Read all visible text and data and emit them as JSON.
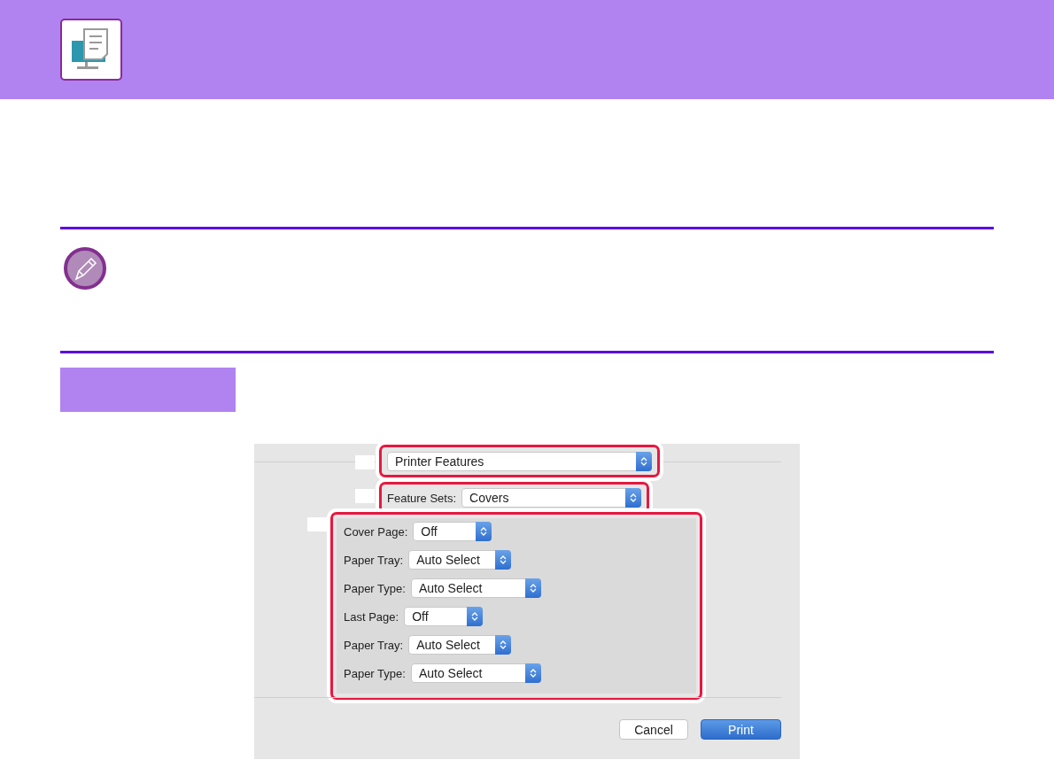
{
  "dialog": {
    "preset_popup": {
      "value": "Printer Features"
    },
    "feature_sets": {
      "label": "Feature Sets:",
      "value": "Covers"
    },
    "options": [
      {
        "label": "Cover Page:",
        "value": "Off"
      },
      {
        "label": "Paper Tray:",
        "value": "Auto Select"
      },
      {
        "label": "Paper Type:",
        "value": "Auto Select"
      },
      {
        "label": "Last Page:",
        "value": "Off"
      },
      {
        "label": "Paper Tray:",
        "value": "Auto Select"
      },
      {
        "label": "Paper Type:",
        "value": "Auto Select"
      }
    ],
    "buttons": [
      {
        "label": "Cancel",
        "default": false
      },
      {
        "label": "Print",
        "default": true
      }
    ]
  }
}
